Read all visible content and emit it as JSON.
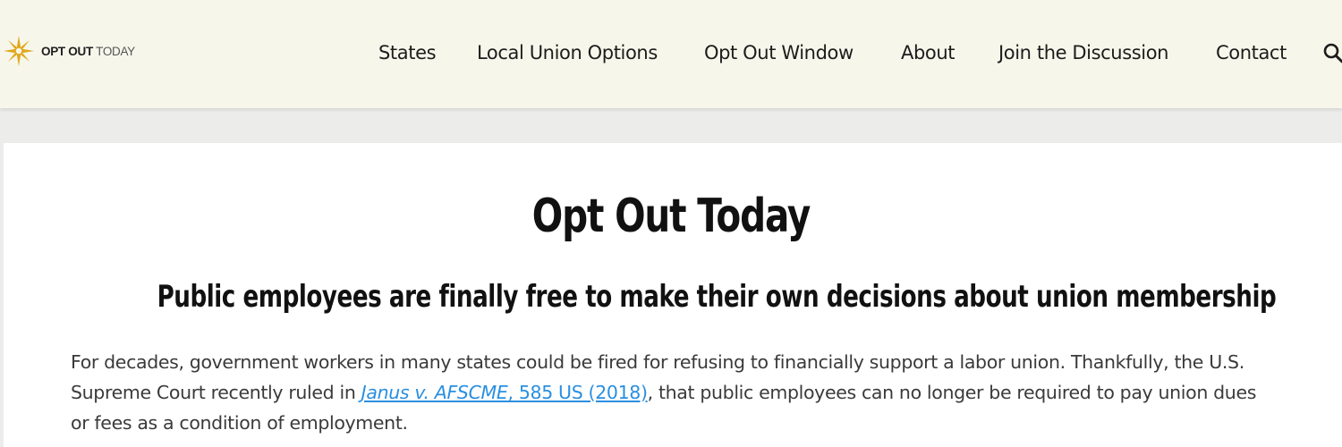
{
  "header": {
    "logo": {
      "bold_text": "OPT OUT",
      "light_text": "TODAY",
      "icon": "sunburst-star-icon",
      "accent_color": "#e0a81c"
    },
    "nav": [
      {
        "label": "States"
      },
      {
        "label": "Local Union Options"
      },
      {
        "label": "Opt Out Window"
      },
      {
        "label": "About"
      },
      {
        "label": "Join the Discussion"
      },
      {
        "label": "Contact"
      }
    ],
    "search_icon": "search-icon"
  },
  "main": {
    "title": "Opt Out Today",
    "subtitle": "Public employees are finally free to make their own decisions about union membership",
    "intro": {
      "before_link": "For decades, government workers in many states could be fired for refusing to financially support a labor union. Thankfully, the U.S. Supreme Court recently ruled in ",
      "link_case": "Janus v. AFSCME",
      "link_citation": ", 585 US  (2018)",
      "after_link": ", that public employees can no longer be required to pay union dues or fees as a condition of employment."
    }
  },
  "colors": {
    "header_bg": "#f7f6ea",
    "page_bg": "#ececea",
    "card_bg": "#ffffff",
    "link": "#2a8fe0",
    "text": "#3a3a3a"
  }
}
